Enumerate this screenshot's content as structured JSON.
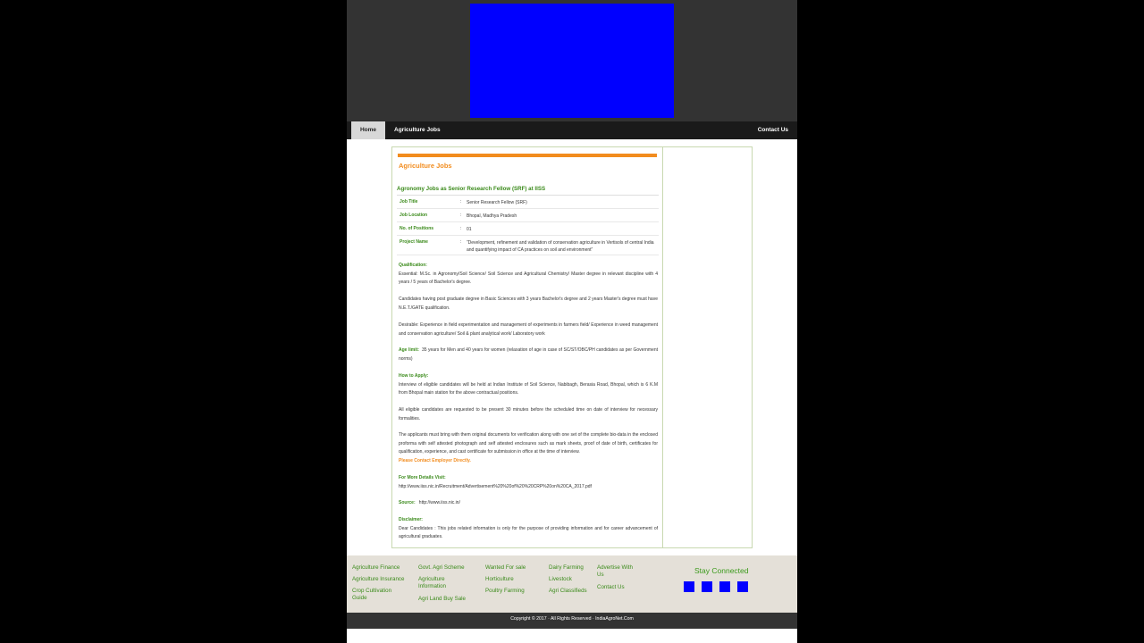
{
  "colors": {
    "accent_orange": "#f28c1e",
    "text_green": "#3a8a1a",
    "banner_blue": "#0000ff",
    "header_bg": "#333333",
    "footer_bg": "#e4e0d8"
  },
  "nav": {
    "home": "Home",
    "agri_jobs": "Agriculture Jobs",
    "contact": "Contact Us"
  },
  "main": {
    "section_title": "Agriculture Jobs",
    "job_heading": "Agronomy Jobs as Senior Research Fellow (SRF) at IISS",
    "info": [
      {
        "label": "Job Title",
        "colon": ":",
        "value": "Senior Research Fellow (SRF)"
      },
      {
        "label": "Job Location",
        "colon": ":",
        "value": "Bhopal, Madhya Pradesh"
      },
      {
        "label": "No. of Positions",
        "colon": ":",
        "value": "01"
      },
      {
        "label": "Project Name",
        "colon": ":",
        "value": "“Development, refinement and validation of conservation agriculture in Vertisols of central India and quantifying impact of CA practices on soil and environment”"
      }
    ],
    "qualification_heading": "Qualification:",
    "qualification_essential": "Essential: M.Sc. in Agronomy/Soil Science/ Soil Science and Agricultural Chemistry/ Master degree in relevant discipline with 4 years / 5 years of Bachelor's degree.",
    "qualification_candidates": "Candidates having post graduate degree in Basic Sciences with 3 years Bachelor's degree and 2 years Master's degree must have N.E.T./GATE qualification.",
    "qualification_desirable": "Desirable: Experience in field experimentation and management of experiments in farmers field/ Experience in weed management and conservation agriculture/ Soil & plant analytical work/ Laboratory work",
    "age_label": "Age limit:",
    "age_text": "35 years for Men and 40 years for women (relaxation of age in case of SC/ST/OBC/PH candidates as per Government norms)",
    "apply_heading": "How to Apply:",
    "apply_text1": "Interview of eligible candidates will be held at Indian Institute of Soil Science, Nabibagh, Berasia Road, Bhopal, which is 6 K.M from Bhopal main station for the above contractual positions.",
    "apply_text2": "All eligible candidates are requested to be present 30 minutes before the scheduled time on date of interview for necessary formalities.",
    "apply_text3": "The applicants must bring with them original documents for verification along with one set of the complete bio-data in the enclosed proforma with self attested photograph and self attested enclosures such as mark sheets, proof of date of birth, certificates for qualification, experience, and cast certificate for submission in office at the time of interview.",
    "contact_employer": "Please Contact Employer Directly.",
    "details_heading": "For More Details Visit:",
    "details_url": "http://www.iiss.nic.in/Recruitment/Advertisement%20%20of%20%20CRP%20on%20CA_2017.pdf",
    "source_label": "Source:",
    "source_url": "http://www.iiss.nic.in/",
    "disclaimer_heading": "Disclaimer:",
    "disclaimer_text": "Dear Candidates : This jobs related information is only for the purpose of providing information and for career advancement of agricultural graduates."
  },
  "footer": {
    "col1": [
      "Agriculture Finance",
      "Agriculture Insurance",
      "Crop Cultivation Guide"
    ],
    "col2": [
      "Govt. Agri Scheme",
      "Agriculture Information",
      "Agri Land Buy Sale"
    ],
    "col3": [
      "Wanted For sale",
      "Horticulture",
      "Poultry Farming"
    ],
    "col4": [
      "Dairy Farming",
      "Livestock",
      "Agri Classifieds"
    ],
    "col5": [
      "Advertise With Us",
      "Contact Us"
    ],
    "stay_connected": "Stay Connected",
    "copyright": "Copyright © 2017 · All Rights Reserved · IndiaAgroNet.Com"
  }
}
